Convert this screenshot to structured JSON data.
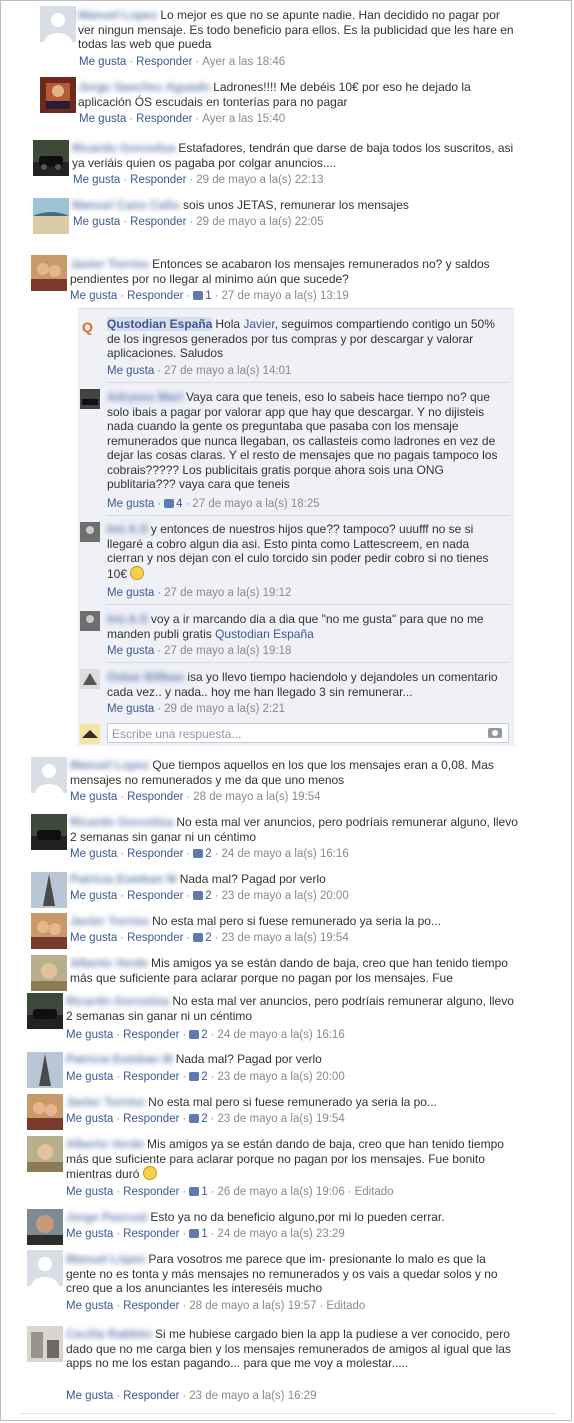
{
  "actions": {
    "like": "Me gusta",
    "reply": "Responder",
    "edited": "Editado"
  },
  "reply_box": {
    "placeholder": "Escribe una respuesta..."
  },
  "comments": [
    {
      "name": "Manuel Lopez",
      "text": "Lo mejor es que no se apunte nadie. Han decidido no pagar por ver ningun mensaje. Es todo beneficio para ellos. Es la publicidad que les hare en todas las web que pueda",
      "likes": "",
      "time": "Ayer a las 18:46",
      "avatar": "default-avatar"
    },
    {
      "name": "Jorge Sanchez Aguado",
      "text": "Ladrones!!!! Me debéis 10€ por eso he dejado la aplicación ÓS escudais en tonterías para no pagar",
      "likes": "",
      "time": "Ayer a las 15:40",
      "avatar": "photo-avatar"
    },
    {
      "name": "Ricardo Gorostiza",
      "text": "Estafadores, tendrán que darse de baja todos los suscritos, asi ya veriáis quien os pagaba por colgar anuncios....",
      "likes": "",
      "time": "29 de mayo a la(s) 22:13",
      "avatar": "car-avatar"
    },
    {
      "name": "Manuel Cano Caño",
      "text": "sois unos JETAS, remunerar los mensajes",
      "likes": "",
      "time": "29 de mayo a la(s) 22:05",
      "avatar": "beach-avatar"
    },
    {
      "name": "Javier Torrmo",
      "text": "Entonces se acabaron los mensajes remunerados no? y saldos pendientes por no llegar al minimo aún que sucede?",
      "likes": "1",
      "time": "27 de mayo a la(s) 13:19",
      "avatar": "couple-avatar"
    }
  ],
  "replies": [
    {
      "name": "Qustodian España",
      "text_before": "Hola ",
      "mention": "Javier",
      "text": ", seguimos compartiendo contigo un 50% de los ingresos generados por tus compras y por descargar y valorar aplicaciones. Saludos",
      "likes": "",
      "time": "27 de mayo a la(s) 14:01"
    },
    {
      "name": "Adryees Mart",
      "text": "Vaya cara que teneis, eso lo sabeis hace tiempo no? que solo ibais a pagar por valorar app que hay que descargar. Y no dijisteis nada cuando la gente os preguntaba que pasaba con los mensaje remunerados que nunca llegaban, os callasteis como ladrones en vez de dejar las cosas claras. Y el resto de mensajes que no pagais tampoco los cobrais????? Los publicitais gratis porque ahora sois una ONG publitaria??? vaya cara que teneis",
      "likes": "4",
      "time": "27 de mayo a la(s) 18:25"
    },
    {
      "name": "Inú A.S",
      "text": "y entonces de nuestros hijos que?? tampoco? uuufff no se si llegaré a cobro algun dia asi. Esto pinta como Lattescreem, en nada cierran y nos dejan con el culo torcido sin poder pedir cobro si no tienes 10€",
      "likes": "",
      "time": "27 de mayo a la(s) 19:12"
    },
    {
      "name": "Inú A.S",
      "text": "voy a ir marcando dia a dia que \"no me gusta\" para que no me manden publi gratis",
      "mention": "Qustodian España",
      "likes": "",
      "time": "27 de mayo a la(s) 19:18"
    },
    {
      "name": "Oskar Billbao",
      "text": "isa yo llevo tiempo haciendolo y dejandoles un comentario cada vez.. y nada.. hoy me han llegado 3 sin remunerar...",
      "likes": "",
      "time": "29 de mayo a la(s) 2:21"
    }
  ],
  "comments2": [
    {
      "name": "Manuel Lopez",
      "text": "Que tiempos aquellos en los que los mensajes eran a 0,08. Mas mensajes no remunerados y me da que uno menos",
      "likes": "",
      "time": "28 de mayo a la(s) 19:54"
    },
    {
      "name": "Ricardo Gorostiza",
      "text": "No esta mal ver anuncios, pero podríais remunerar alguno, llevo 2 semanas sin ganar ni un céntimo",
      "likes": "2",
      "time": "24 de mayo a la(s) 16:16"
    },
    {
      "name": "Patricia Esteban M",
      "text": "Nada mal? Pagad por verlo",
      "likes": "2",
      "time": "23 de mayo a la(s) 20:00"
    },
    {
      "name": "Javier Torrmo",
      "text": "No esta mal pero si fuese remunerado ya seria la po...",
      "likes": "2",
      "time": "23 de mayo a la(s) 19:54"
    },
    {
      "name": "Alberto Verde",
      "text": "Mis amigos ya se están dando de baja, creo que han tenido tiempo más que suficiente para aclarar porque no pagan por los mensajes. Fue",
      "likes": "",
      "time": ""
    },
    {
      "name": "Ricardo Gorostiza",
      "text": "No esta mal ver anuncios, pero podríais remunerar alguno, llevo 2 semanas sin ganar ni un céntimo",
      "likes": "2",
      "time": "24 de mayo a la(s) 16:16"
    },
    {
      "name": "Patricia Esteban M",
      "text": "Nada mal? Pagad por verlo",
      "likes": "2",
      "time": "23 de mayo a la(s) 20:00"
    },
    {
      "name": "Javier Torrmo",
      "text": "No esta mal pero si fuese remunerado ya seria la po...",
      "likes": "2",
      "time": "23 de mayo a la(s) 19:54"
    },
    {
      "name": "Alberto Verde",
      "text": "Mis amigos ya se están dando de baja, creo que han tenido tiempo más que suficiente para aclarar porque no pagan por los mensajes. Fue bonito mientras duró",
      "likes": "1",
      "time": "26 de mayo a la(s) 19:06"
    },
    {
      "name": "Jorge Pascual",
      "text": "Esto ya no da beneficio alguno,por mi lo pueden cerrar.",
      "likes": "1",
      "time": "24 de mayo a la(s) 23:29"
    },
    {
      "name": "Manuel López",
      "text": "Para vosotros me parece que im- presionante lo malo es que la gente no es tonta y más mensajes no remunerados y os vais a quedar solos y no creo que a los anunciantes les intereséis mucho",
      "likes": "",
      "time": "28 de mayo a la(s) 19:57"
    },
    {
      "name": "Cecilia Rabbits",
      "text": "Si me hubiese cargado bien la app la pudiese a ver conocido, pero dado que no me carga bien y los mensajes remunerados de amigos al igual que las apps no me los estan pagando... para que me voy a molestar.....",
      "likes": "",
      "time": "23 de mayo a la(s) 16:29"
    }
  ]
}
